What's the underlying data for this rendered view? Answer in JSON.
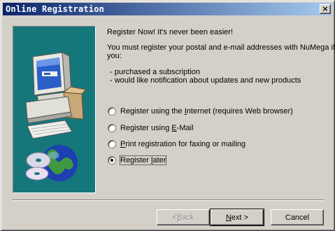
{
  "window": {
    "title": "Online Registration",
    "close_label": "×"
  },
  "content": {
    "headline": "Register Now!  It's never been easier!",
    "intro_line1": "You must register your postal and e-mail addresses with NuMega if",
    "intro_line2": "you:",
    "bullet1": "- purchased a subscription",
    "bullet2": "- would like notification about updates and new products"
  },
  "options": [
    {
      "pre": "Register using the ",
      "mnemonic": "I",
      "post": "nternet (requires Web browser)",
      "checked": false
    },
    {
      "pre": "Register using ",
      "mnemonic": "E",
      "post": "-Mail",
      "checked": false
    },
    {
      "pre": "",
      "mnemonic": "P",
      "post": "rint registration for faxing or mailing",
      "checked": false
    },
    {
      "pre": "Register ",
      "mnemonic": "l",
      "post": "ater",
      "checked": true
    }
  ],
  "buttons": {
    "back": {
      "pre": "< ",
      "mnemonic": "B",
      "post": "ack",
      "enabled": false
    },
    "next": {
      "pre": "",
      "mnemonic": "N",
      "post": "ext >",
      "enabled": true
    },
    "cancel": {
      "label": "Cancel",
      "enabled": true
    }
  },
  "colors": {
    "title_bar_start": "#0a246a",
    "title_bar_end": "#a6caf0",
    "art_background": "#16777b",
    "dialog_face": "#d4d0c8"
  },
  "icons": {
    "art": "computer-with-globe-and-cd",
    "close": "close-icon"
  }
}
